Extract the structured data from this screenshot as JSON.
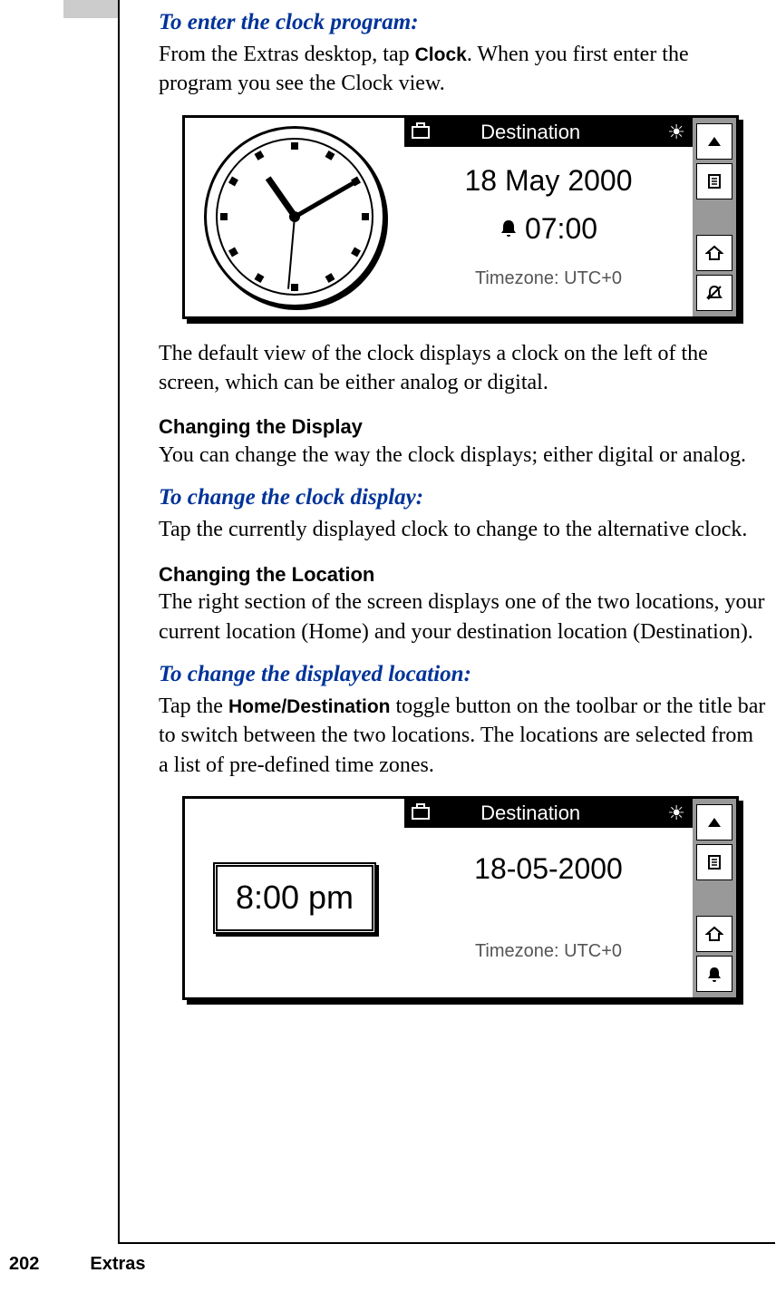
{
  "h1": "To enter the clock program:",
  "p1a": "From the Extras desktop, tap ",
  "p1b": "Clock",
  "p1c": ". When you first enter the program you see the Clock view.",
  "fig1": {
    "titlebar": "Destination",
    "date": "18 May 2000",
    "time": "07:00",
    "tz": "Timezone: UTC+0"
  },
  "p2": "The default view of the clock displays a clock on the left of the screen, which can be either analog or digital.",
  "h2": "Changing the Display",
  "p3": "You can change the way the clock displays; either digital or analog.",
  "h3": "To change the clock display:",
  "p4": "Tap the currently displayed clock to change to the alternative clock.",
  "h4": "Changing the Location",
  "p5": "The right section of the screen displays one of the two locations, your current location (Home) and your destination location (Destination).",
  "h5": "To change the displayed location:",
  "p6a": "Tap the ",
  "p6b": "Home/Destination",
  "p6c": " toggle button on the toolbar or the title bar to switch between the two locations. The locations are selected from a list of pre-defined time zones.",
  "fig2": {
    "titlebar": "Destination",
    "digital": "8:00 pm",
    "date": "18-05-2000",
    "tz": "Timezone: UTC+0"
  },
  "footer": {
    "pagenum": "202",
    "section": "Extras"
  }
}
